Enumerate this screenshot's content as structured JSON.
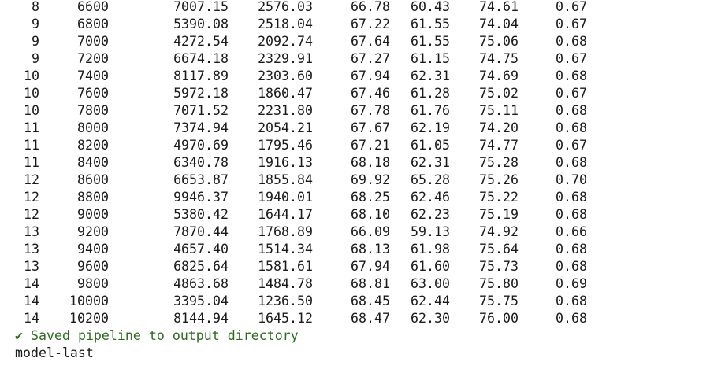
{
  "table": {
    "rows": [
      [
        "8",
        "6600",
        "7007.15",
        "2576.03",
        "66.78",
        "60.43",
        "74.61",
        "0.67"
      ],
      [
        "9",
        "6800",
        "5390.08",
        "2518.04",
        "67.22",
        "61.55",
        "74.04",
        "0.67"
      ],
      [
        "9",
        "7000",
        "4272.54",
        "2092.74",
        "67.64",
        "61.55",
        "75.06",
        "0.68"
      ],
      [
        "9",
        "7200",
        "6674.18",
        "2329.91",
        "67.27",
        "61.15",
        "74.75",
        "0.67"
      ],
      [
        "10",
        "7400",
        "8117.89",
        "2303.60",
        "67.94",
        "62.31",
        "74.69",
        "0.68"
      ],
      [
        "10",
        "7600",
        "5972.18",
        "1860.47",
        "67.46",
        "61.28",
        "75.02",
        "0.67"
      ],
      [
        "10",
        "7800",
        "7071.52",
        "2231.80",
        "67.78",
        "61.76",
        "75.11",
        "0.68"
      ],
      [
        "11",
        "8000",
        "7374.94",
        "2054.21",
        "67.67",
        "62.19",
        "74.20",
        "0.68"
      ],
      [
        "11",
        "8200",
        "4970.69",
        "1795.46",
        "67.21",
        "61.05",
        "74.77",
        "0.67"
      ],
      [
        "11",
        "8400",
        "6340.78",
        "1916.13",
        "68.18",
        "62.31",
        "75.28",
        "0.68"
      ],
      [
        "12",
        "8600",
        "6653.87",
        "1855.84",
        "69.92",
        "65.28",
        "75.26",
        "0.70"
      ],
      [
        "12",
        "8800",
        "9946.37",
        "1940.01",
        "68.25",
        "62.46",
        "75.22",
        "0.68"
      ],
      [
        "12",
        "9000",
        "5380.42",
        "1644.17",
        "68.10",
        "62.23",
        "75.19",
        "0.68"
      ],
      [
        "13",
        "9200",
        "7870.44",
        "1768.89",
        "66.09",
        "59.13",
        "74.92",
        "0.66"
      ],
      [
        "13",
        "9400",
        "4657.40",
        "1514.34",
        "68.13",
        "61.98",
        "75.64",
        "0.68"
      ],
      [
        "13",
        "9600",
        "6825.64",
        "1581.61",
        "67.94",
        "61.60",
        "75.73",
        "0.68"
      ],
      [
        "14",
        "9800",
        "4863.68",
        "1484.78",
        "68.81",
        "63.00",
        "75.80",
        "0.69"
      ],
      [
        "14",
        "10000",
        "3395.04",
        "1236.50",
        "68.45",
        "62.44",
        "75.75",
        "0.68"
      ],
      [
        "14",
        "10200",
        "8144.94",
        "1645.12",
        "68.47",
        "62.30",
        "76.00",
        "0.68"
      ]
    ]
  },
  "messages": {
    "success_icon": "✔",
    "success_text": "Saved pipeline to output directory",
    "output_dir": "model-last"
  },
  "colors": {
    "success": "#2e6b1f",
    "text": "#1a1a1a",
    "background": "#ffffff"
  }
}
